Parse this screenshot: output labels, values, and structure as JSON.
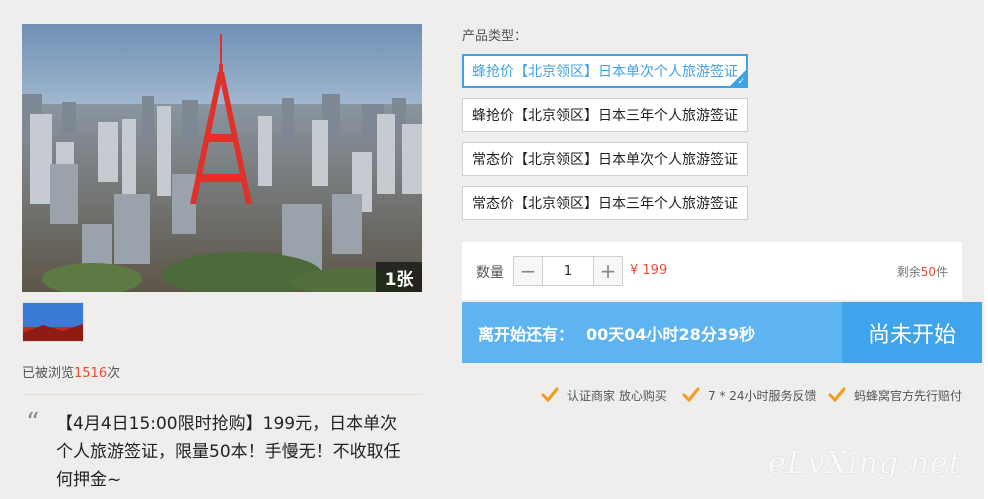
{
  "gallery": {
    "photo_count": "1张"
  },
  "views": {
    "prefix": "已被浏览",
    "count": "1516",
    "suffix": "次"
  },
  "description": {
    "quote_mark": "“",
    "text": "【4月4日15:00限时抢购】199元，日本单次个人旅游签证，限量50本！手慢无！不收取任何押金~"
  },
  "product_type": {
    "label": "产品类型：",
    "options": [
      {
        "label": "蜂抢价【北京领区】日本单次个人旅游签证",
        "selected": true
      },
      {
        "label": "蜂抢价【北京领区】日本三年个人旅游签证",
        "selected": false
      },
      {
        "label": "常态价【北京领区】日本单次个人旅游签证",
        "selected": false
      },
      {
        "label": "常态价【北京领区】日本三年个人旅游签证",
        "selected": false
      }
    ]
  },
  "quantity": {
    "label": "数量",
    "minus": "−",
    "value": "1",
    "plus": "+",
    "price": "¥ 199",
    "stock_prefix": "剩余",
    "stock_count": "50",
    "stock_suffix": "件"
  },
  "countdown": {
    "label": "离开始还有：",
    "time": "00天04小时28分39秒",
    "button": "尚未开始"
  },
  "guarantees": [
    {
      "text": "认证商家 放心购买",
      "icon": "check-icon"
    },
    {
      "text": "7 * 24小时服务反馈",
      "icon": "check-icon"
    },
    {
      "text": "蚂蜂窝官方先行赔付",
      "icon": "check-icon"
    }
  ],
  "watermark": "eLvXing.net",
  "colors": {
    "accent_blue": "#3fa1e6",
    "countdown_bg": "#5eb4f1",
    "price_red": "#e64c33",
    "check_orange": "#f59a1c"
  }
}
